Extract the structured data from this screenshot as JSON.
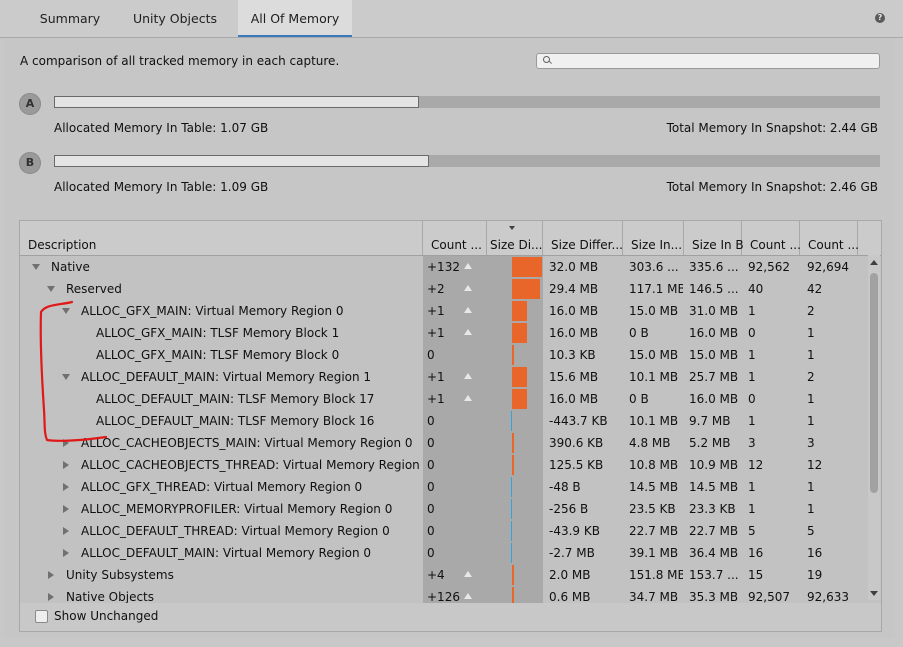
{
  "tabs": [
    {
      "label": "Summary",
      "active": false
    },
    {
      "label": "Unity Objects",
      "active": false
    },
    {
      "label": "All Of Memory",
      "active": true
    }
  ],
  "description": "A comparison of all tracked memory in each capture.",
  "search": {
    "placeholder": ""
  },
  "captures": [
    {
      "letter": "A",
      "allocated_label": "Allocated Memory In Table: 1.07 GB",
      "total_label": "Total Memory In Snapshot: 2.44 GB",
      "fill_fraction": 0.44
    },
    {
      "letter": "B",
      "allocated_label": "Allocated Memory In Table: 1.09 GB",
      "total_label": "Total Memory In Snapshot: 2.46 GB",
      "fill_fraction": 0.44
    }
  ],
  "table": {
    "columns": [
      "Description",
      "Count ...",
      "Size Di...",
      "Size Differ...",
      "Size In...",
      "Size In B",
      "Count ...",
      "Count ..."
    ],
    "rows": [
      {
        "level": 0,
        "toggle": "down",
        "name": "Native",
        "count_diff": "+132",
        "up": true,
        "size_diff": "32.0 MB",
        "size_a": "303.6 ...",
        "size_b": "335.6 ...",
        "count_a": "92,562",
        "count_b": "92,694",
        "bar": {
          "dir": "pos",
          "frac": 1.0
        }
      },
      {
        "level": 1,
        "toggle": "down",
        "name": "Reserved",
        "count_diff": "+2",
        "up": true,
        "size_diff": "29.4 MB",
        "size_a": "117.1 MB",
        "size_b": "146.5 ...",
        "count_a": "40",
        "count_b": "42",
        "bar": {
          "dir": "pos",
          "frac": 0.92
        }
      },
      {
        "level": 2,
        "toggle": "down",
        "name": "ALLOC_GFX_MAIN: Virtual Memory Region 0",
        "count_diff": "+1",
        "up": true,
        "size_diff": "16.0 MB",
        "size_a": "15.0 MB",
        "size_b": "31.0 MB",
        "count_a": "1",
        "count_b": "2",
        "bar": {
          "dir": "pos",
          "frac": 0.5
        }
      },
      {
        "level": 3,
        "toggle": "none",
        "name": "ALLOC_GFX_MAIN: TLSF Memory Block 1",
        "count_diff": "+1",
        "up": true,
        "size_diff": "16.0 MB",
        "size_a": "0 B",
        "size_b": "16.0 MB",
        "count_a": "0",
        "count_b": "1",
        "bar": {
          "dir": "pos",
          "frac": 0.5
        }
      },
      {
        "level": 3,
        "toggle": "none",
        "name": "ALLOC_GFX_MAIN: TLSF Memory Block 0",
        "count_diff": "0",
        "up": false,
        "size_diff": "10.3 KB",
        "size_a": "15.0 MB",
        "size_b": "15.0 MB",
        "count_a": "1",
        "count_b": "1",
        "bar": {
          "dir": "pos",
          "frac": 0.02
        }
      },
      {
        "level": 2,
        "toggle": "down",
        "name": "ALLOC_DEFAULT_MAIN: Virtual Memory Region 1",
        "count_diff": "+1",
        "up": true,
        "size_diff": "15.6 MB",
        "size_a": "10.1 MB",
        "size_b": "25.7 MB",
        "count_a": "1",
        "count_b": "2",
        "bar": {
          "dir": "pos",
          "frac": 0.49
        }
      },
      {
        "level": 3,
        "toggle": "none",
        "name": "ALLOC_DEFAULT_MAIN: TLSF Memory Block 17",
        "count_diff": "+1",
        "up": true,
        "size_diff": "16.0 MB",
        "size_a": "0 B",
        "size_b": "16.0 MB",
        "count_a": "0",
        "count_b": "1",
        "bar": {
          "dir": "pos",
          "frac": 0.5
        }
      },
      {
        "level": 3,
        "toggle": "none",
        "name": "ALLOC_DEFAULT_MAIN: TLSF Memory Block 16",
        "count_diff": "0",
        "up": false,
        "size_diff": "-443.7 KB",
        "size_a": "10.1 MB",
        "size_b": "9.7 MB",
        "count_a": "1",
        "count_b": "1",
        "bar": {
          "dir": "neg",
          "frac": 0.02
        }
      },
      {
        "level": 2,
        "toggle": "right",
        "name": "ALLOC_CACHEOBJECTS_MAIN: Virtual Memory Region 0",
        "count_diff": "0",
        "up": false,
        "size_diff": "390.6 KB",
        "size_a": "4.8 MB",
        "size_b": "5.2 MB",
        "count_a": "3",
        "count_b": "3",
        "bar": {
          "dir": "pos",
          "frac": 0.02
        }
      },
      {
        "level": 2,
        "toggle": "right",
        "name": "ALLOC_CACHEOBJECTS_THREAD: Virtual Memory Region 0",
        "count_diff": "0",
        "up": false,
        "size_diff": "125.5 KB",
        "size_a": "10.8 MB",
        "size_b": "10.9 MB",
        "count_a": "12",
        "count_b": "12",
        "bar": {
          "dir": "pos",
          "frac": 0.02
        }
      },
      {
        "level": 2,
        "toggle": "right",
        "name": "ALLOC_GFX_THREAD: Virtual Memory Region 0",
        "count_diff": "0",
        "up": false,
        "size_diff": "-48 B",
        "size_a": "14.5 MB",
        "size_b": "14.5 MB",
        "count_a": "1",
        "count_b": "1",
        "bar": {
          "dir": "neg",
          "frac": 0.02
        }
      },
      {
        "level": 2,
        "toggle": "right",
        "name": "ALLOC_MEMORYPROFILER: Virtual Memory Region 0",
        "count_diff": "0",
        "up": false,
        "size_diff": "-256 B",
        "size_a": "23.5 KB",
        "size_b": "23.3 KB",
        "count_a": "1",
        "count_b": "1",
        "bar": {
          "dir": "neg",
          "frac": 0.02
        }
      },
      {
        "level": 2,
        "toggle": "right",
        "name": "ALLOC_DEFAULT_THREAD: Virtual Memory Region 0",
        "count_diff": "0",
        "up": false,
        "size_diff": "-43.9 KB",
        "size_a": "22.7 MB",
        "size_b": "22.7 MB",
        "count_a": "5",
        "count_b": "5",
        "bar": {
          "dir": "neg",
          "frac": 0.02
        }
      },
      {
        "level": 2,
        "toggle": "right",
        "name": "ALLOC_DEFAULT_MAIN: Virtual Memory Region 0",
        "count_diff": "0",
        "up": false,
        "size_diff": "-2.7 MB",
        "size_a": "39.1 MB",
        "size_b": "36.4 MB",
        "count_a": "16",
        "count_b": "16",
        "bar": {
          "dir": "neg",
          "frac": 0.02
        }
      },
      {
        "level": 1,
        "toggle": "right",
        "name": "Unity Subsystems",
        "count_diff": "+4",
        "up": true,
        "size_diff": "2.0 MB",
        "size_a": "151.8 MB",
        "size_b": "153.7 ...",
        "count_a": "15",
        "count_b": "19",
        "bar": {
          "dir": "pos",
          "frac": 0.06
        }
      },
      {
        "level": 1,
        "toggle": "right",
        "name": "Native Objects",
        "count_diff": "+126",
        "up": true,
        "size_diff": "0.6 MB",
        "size_a": "34.7 MB",
        "size_b": "35.3 MB",
        "count_a": "92,507",
        "count_b": "92,633",
        "bar": {
          "dir": "pos",
          "frac": 0.03
        }
      }
    ]
  },
  "footer": {
    "checkbox_label": "Show Unchanged",
    "checked": false
  },
  "colors": {
    "increase_bar": "#e8662a",
    "decrease_bar": "#3aa0d8",
    "tab_underline": "#3a79bb",
    "annotation": "#e01818"
  },
  "annotation": {
    "type": "red-freehand-bracket"
  }
}
